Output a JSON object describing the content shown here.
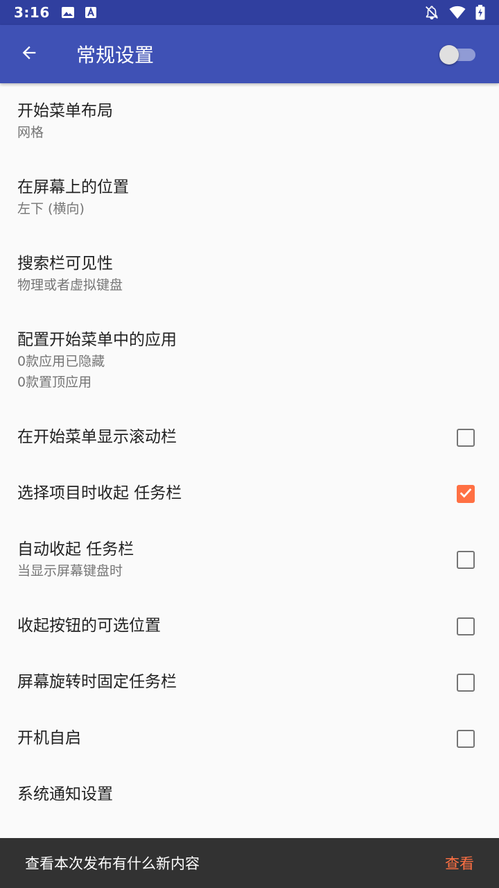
{
  "status_bar": {
    "time": "3:16",
    "icons": [
      "image-icon",
      "text-a-icon",
      "notifications-off-icon",
      "wifi-icon",
      "battery-charging-icon"
    ]
  },
  "app_bar": {
    "title": "常规设置",
    "back_icon": "arrow-back-icon",
    "master_switch_on": false,
    "color": "#3f51b5"
  },
  "prefs": [
    {
      "title": "开始菜单布局",
      "summary": [
        "网格"
      ]
    },
    {
      "title": "在屏幕上的位置",
      "summary": [
        "左下 (横向)"
      ]
    },
    {
      "title": "搜索栏可见性",
      "summary": [
        "物理或者虚拟键盘"
      ]
    },
    {
      "title": "配置开始菜单中的应用",
      "summary": [
        "0款应用已隐藏",
        "0款置顶应用"
      ]
    },
    {
      "title": "在开始菜单显示滚动栏",
      "checked": false
    },
    {
      "title": "选择项目时收起 任务栏",
      "checked": true
    },
    {
      "title": "自动收起 任务栏",
      "summary": [
        "当显示屏幕键盘时"
      ],
      "checked": false
    },
    {
      "title": "收起按钮的可选位置",
      "checked": false
    },
    {
      "title": "屏幕旋转时固定任务栏",
      "checked": false
    },
    {
      "title": "开机自启",
      "checked": false
    },
    {
      "title": "系统通知设置"
    }
  ],
  "snackbar": {
    "message": "查看本次发布有什么新内容",
    "action": "查看",
    "action_color": "#ff7043"
  }
}
